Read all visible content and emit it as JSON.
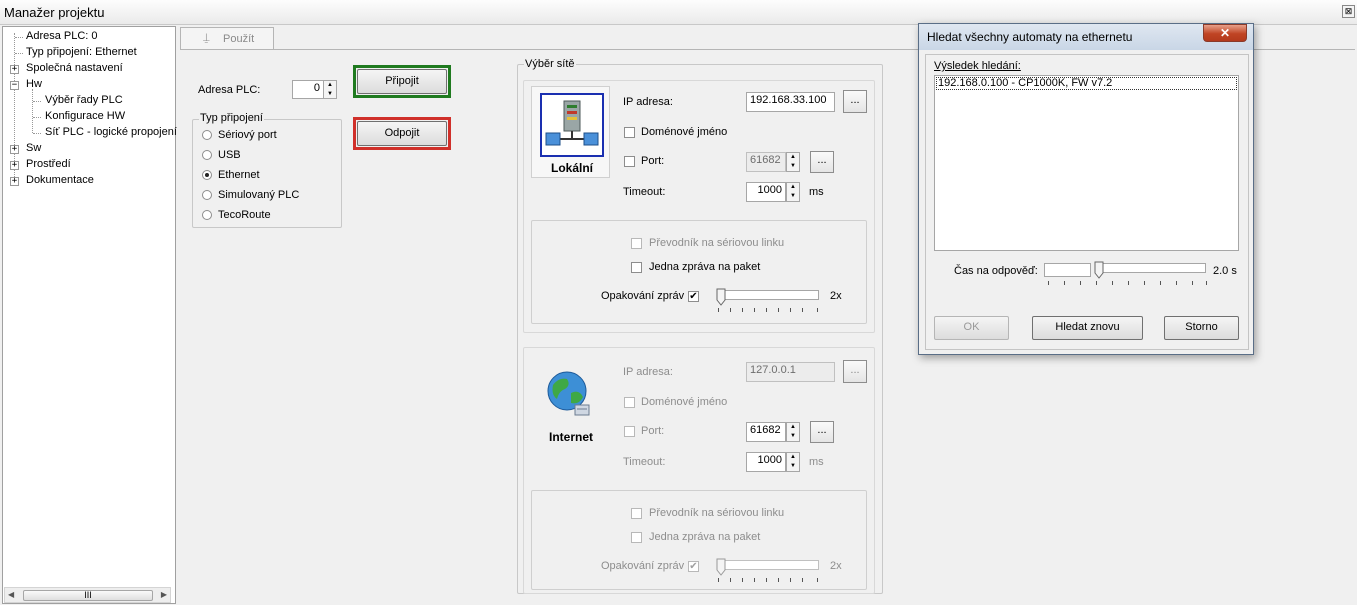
{
  "window": {
    "title": "Manažer projektu",
    "close_glyph": "⊠"
  },
  "tree": {
    "items": [
      {
        "label": "Adresa PLC: 0"
      },
      {
        "label": "Typ připojení: Ethernet"
      },
      {
        "label": "Společná nastavení"
      },
      {
        "label": "Hw"
      },
      {
        "label": "Výběr řady PLC"
      },
      {
        "label": "Konfigurace HW"
      },
      {
        "label": "Síť PLC - logické propojení"
      },
      {
        "label": "Sw"
      },
      {
        "label": "Prostředí"
      },
      {
        "label": "Dokumentace"
      }
    ],
    "scroll_thumb": "III"
  },
  "toolbar": {
    "apply_label": "Použít"
  },
  "plc": {
    "address_label": "Adresa PLC:",
    "address_value": "0",
    "connect_label": "Připojit",
    "disconnect_label": "Odpojit"
  },
  "connection_type": {
    "group_label": "Typ připojení",
    "options": [
      "Sériový port",
      "USB",
      "Ethernet",
      "Simulovaný PLC",
      "TecoRoute"
    ],
    "selected": "Ethernet"
  },
  "network": {
    "group_label": "Výběr sítě",
    "local": {
      "caption": "Lokální",
      "ip_label": "IP adresa:",
      "ip_value": "192.168.33.100",
      "browse_label": "...",
      "domain_label": "Doménové jméno",
      "port_label": "Port:",
      "port_value": "61682",
      "port_btn": "...",
      "timeout_label": "Timeout:",
      "timeout_value": "1000",
      "timeout_unit": "ms",
      "serial_conv_label": "Převodník na sériovou linku",
      "one_msg_label": "Jedna zpráva na paket",
      "repeat_label": "Opakování zpráv",
      "repeat_value": "2x",
      "repeat_checked_glyph": "✔"
    },
    "internet": {
      "caption": "Internet",
      "ip_label": "IP adresa:",
      "ip_value": "127.0.0.1",
      "browse_label": "...",
      "domain_label": "Doménové jméno",
      "port_label": "Port:",
      "port_value": "61682",
      "port_btn": "...",
      "timeout_label": "Timeout:",
      "timeout_value": "1000",
      "timeout_unit": "ms",
      "serial_conv_label": "Převodník na sériovou linku",
      "one_msg_label": "Jedna zpráva na paket",
      "repeat_label": "Opakování zpráv",
      "repeat_value": "2x",
      "repeat_checked_glyph": "✔"
    }
  },
  "dialog": {
    "title": "Hledat všechny automaty na ethernetu",
    "close_glyph": "✕",
    "result_label": "Výsledek hledání:",
    "results": [
      "192.168.0.100  - CP1000K, FW v7.2"
    ],
    "response_label": "Čas na odpověď:",
    "response_value": "2.0 s",
    "ok_label": "OK",
    "search_again_label": "Hledat znovu",
    "cancel_label": "Storno"
  },
  "colors": {
    "connect_border": "#1f7a1f",
    "disconnect_border": "#d0302a",
    "local_icon_border": "#1a2fb0"
  }
}
